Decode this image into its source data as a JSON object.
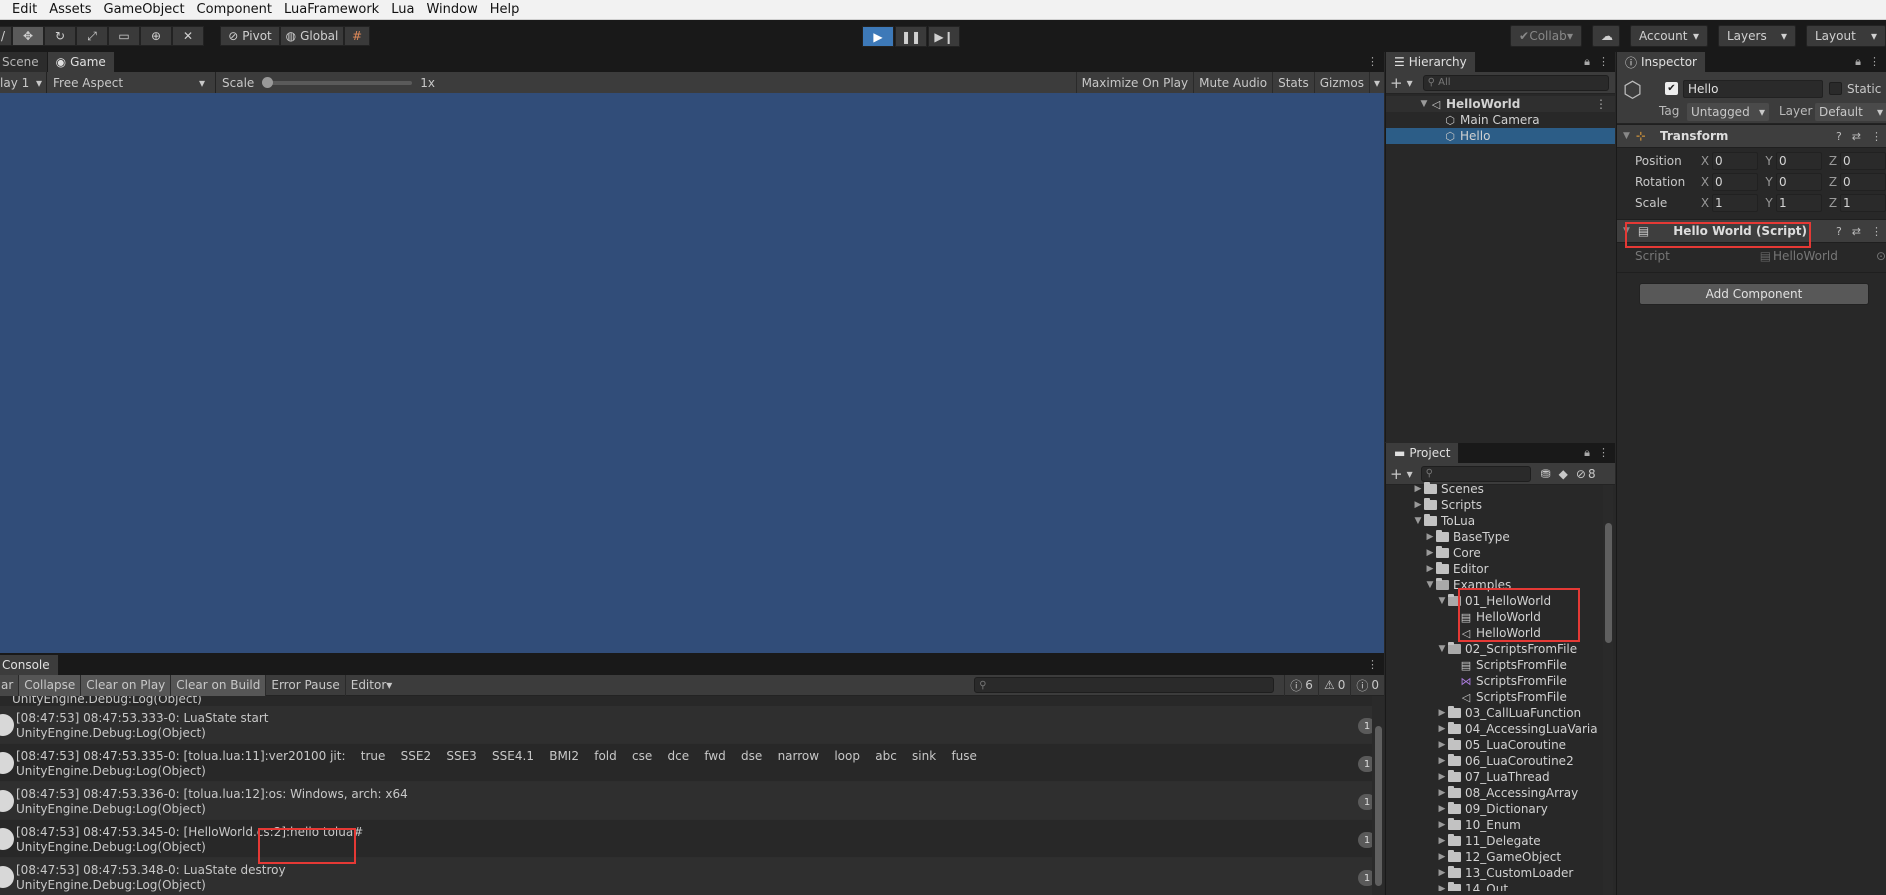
{
  "menubar": {
    "items": [
      "Edit",
      "Assets",
      "GameObject",
      "Component",
      "LuaFramework",
      "Lua",
      "Window",
      "Help"
    ]
  },
  "toolbar": {
    "pivot_label": "Pivot",
    "global_label": "Global",
    "collab_label": "Collab",
    "account_label": "Account",
    "layers_label": "Layers",
    "layout_label": "Layout"
  },
  "game": {
    "tabs": [
      "Scene",
      "Game"
    ],
    "display": "lay 1",
    "aspect": "Free Aspect",
    "scale_label": "Scale",
    "scale_value": "1x",
    "actions": [
      "Maximize On Play",
      "Mute Audio",
      "Stats",
      "Gizmos"
    ],
    "background": "#314d79"
  },
  "console": {
    "tab": "Console",
    "buttons": [
      "ar",
      "Collapse",
      "Clear on Play",
      "Clear on Build",
      "Error Pause",
      "Editor"
    ],
    "log_count": "6",
    "warn_count": "0",
    "error_count": "0",
    "top_partial": "UnityEngine.Debug:Log(Object)",
    "rows": [
      {
        "line1": "[08:47:53] 08:47:53.333-0: LuaState start",
        "line2": "UnityEngine.Debug:Log(Object)",
        "count": "1"
      },
      {
        "line1": "[08:47:53] 08:47:53.335-0: [tolua.lua:11]:ver20100 jit:    true    SSE2    SSE3    SSE4.1    BMI2    fold    cse    dce    fwd    dse    narrow    loop    abc    sink    fuse",
        "line2": "UnityEngine.Debug:Log(Object)",
        "count": "1"
      },
      {
        "line1": "[08:47:53] 08:47:53.336-0: [tolua.lua:12]:os: Windows, arch: x64",
        "line2": "UnityEngine.Debug:Log(Object)",
        "count": "1"
      },
      {
        "line1": "[08:47:53] 08:47:53.345-0: [HelloWorld.cs:2]:hello tolua#",
        "line2": "UnityEngine.Debug:Log(Object)",
        "count": "1"
      },
      {
        "line1": "[08:47:53] 08:47:53.348-0: LuaState destroy",
        "line2": "UnityEngine.Debug:Log(Object)",
        "count": "1"
      }
    ]
  },
  "hierarchy": {
    "tab": "Hierarchy",
    "search_placeholder": "All",
    "scene": "HelloWorld",
    "items": [
      "Main Camera",
      "Hello"
    ]
  },
  "project": {
    "tab": "Project",
    "hidden_count": "8",
    "items": [
      {
        "label": "Scenes",
        "depth": 1,
        "arrow": "▶",
        "icon": "folder"
      },
      {
        "label": "Scripts",
        "depth": 1,
        "arrow": "▶",
        "icon": "folder"
      },
      {
        "label": "ToLua",
        "depth": 1,
        "arrow": "▼",
        "icon": "folder"
      },
      {
        "label": "BaseType",
        "depth": 2,
        "arrow": "▶",
        "icon": "folder"
      },
      {
        "label": "Core",
        "depth": 2,
        "arrow": "▶",
        "icon": "folder"
      },
      {
        "label": "Editor",
        "depth": 2,
        "arrow": "▶",
        "icon": "folder"
      },
      {
        "label": "Examples",
        "depth": 2,
        "arrow": "▼",
        "icon": "folder-open"
      },
      {
        "label": "01_HelloWorld",
        "depth": 3,
        "arrow": "▼",
        "icon": "folder-open"
      },
      {
        "label": "HelloWorld",
        "depth": 4,
        "arrow": "",
        "icon": "script"
      },
      {
        "label": "HelloWorld",
        "depth": 4,
        "arrow": "",
        "icon": "unity-scene"
      },
      {
        "label": "02_ScriptsFromFile",
        "depth": 3,
        "arrow": "▼",
        "icon": "folder-open"
      },
      {
        "label": "ScriptsFromFile",
        "depth": 4,
        "arrow": "",
        "icon": "script"
      },
      {
        "label": "ScriptsFromFile",
        "depth": 4,
        "arrow": "",
        "icon": "vs-file"
      },
      {
        "label": "ScriptsFromFile",
        "depth": 4,
        "arrow": "",
        "icon": "unity-scene"
      },
      {
        "label": "03_CallLuaFunction",
        "depth": 3,
        "arrow": "▶",
        "icon": "folder"
      },
      {
        "label": "04_AccessingLuaVaria",
        "depth": 3,
        "arrow": "▶",
        "icon": "folder"
      },
      {
        "label": "05_LuaCoroutine",
        "depth": 3,
        "arrow": "▶",
        "icon": "folder"
      },
      {
        "label": "06_LuaCoroutine2",
        "depth": 3,
        "arrow": "▶",
        "icon": "folder"
      },
      {
        "label": "07_LuaThread",
        "depth": 3,
        "arrow": "▶",
        "icon": "folder"
      },
      {
        "label": "08_AccessingArray",
        "depth": 3,
        "arrow": "▶",
        "icon": "folder"
      },
      {
        "label": "09_Dictionary",
        "depth": 3,
        "arrow": "▶",
        "icon": "folder"
      },
      {
        "label": "10_Enum",
        "depth": 3,
        "arrow": "▶",
        "icon": "folder"
      },
      {
        "label": "11_Delegate",
        "depth": 3,
        "arrow": "▶",
        "icon": "folder"
      },
      {
        "label": "12_GameObject",
        "depth": 3,
        "arrow": "▶",
        "icon": "folder"
      },
      {
        "label": "13_CustomLoader",
        "depth": 3,
        "arrow": "▶",
        "icon": "folder"
      },
      {
        "label": "14_Out",
        "depth": 3,
        "arrow": "▶",
        "icon": "folder"
      }
    ]
  },
  "inspector": {
    "tab": "Inspector",
    "object_name": "Hello",
    "static_label": "Static",
    "tag_label": "Tag",
    "tag_value": "Untagged",
    "layer_label": "Layer",
    "layer_value": "Default",
    "transform_title": "Transform",
    "position_label": "Position",
    "rotation_label": "Rotation",
    "scale_label": "Scale",
    "position": [
      "0",
      "0",
      "0"
    ],
    "rotation": [
      "0",
      "0",
      "0"
    ],
    "scale": [
      "1",
      "1",
      "1"
    ],
    "script_comp_title": "Hello World (Script)",
    "script_label": "Script",
    "script_value": "HelloWorld",
    "add_component_label": "Add Component"
  },
  "colors": {
    "highlight": "#e53935",
    "selection": "#2c5d87",
    "play_active": "#3d79b8"
  }
}
